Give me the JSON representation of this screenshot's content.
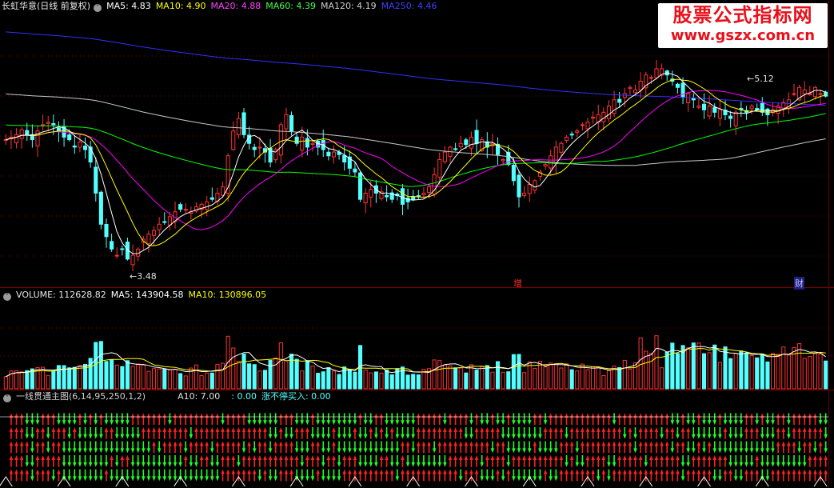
{
  "colors": {
    "up": "#ff3232",
    "down": "#54ffff",
    "ma5": "#ffffff",
    "ma10": "#ffff00",
    "ma20": "#ff00ff",
    "ma60": "#00ff00",
    "ma120": "#c8c8c8",
    "ma250": "#3030ff",
    "grid": "#800000",
    "arrow_up": "#ff2020",
    "arrow_down": "#20ff20"
  },
  "header": {
    "stock": "长虹华意(日线 前复权)",
    "ma5": "MA5: 4.83",
    "ma10": "MA10: 4.90",
    "ma20": "MA20: 4.88",
    "ma60": "MA60: 4.39",
    "ma120": "MA120: 4.19",
    "ma250": "MA250: 4.46"
  },
  "volume_header": {
    "title": "VOLUME: 112628.82",
    "ma5": "MA5: 143904.58",
    "ma10": "MA10: 130896.05"
  },
  "indicator_header": {
    "title": "一线贯通主图(6,14,95,250,1,2)",
    "a10": "A10: 7.00",
    "blank": ": 0.00",
    "buy": "涨不停买入: 0.00"
  },
  "annotations": {
    "low": "←3.48",
    "high": "←5.12",
    "tag1": "增",
    "tag2": "财"
  },
  "watermark": {
    "line1": "股票公式指标网",
    "line2": "www.gszx.com.cn"
  },
  "chart_data": [
    {
      "type": "candlestick",
      "title": "长虹华意(日线 前复权)",
      "ylim": [
        3.3,
        5.5
      ],
      "notes": "daily candles, ~160 sessions; O/H/L/C approximated from the plot",
      "close": [
        4.48,
        4.5,
        4.52,
        4.56,
        4.52,
        4.48,
        4.55,
        4.6,
        4.62,
        4.6,
        4.55,
        4.5,
        4.48,
        4.42,
        4.46,
        4.4,
        4.3,
        4.05,
        3.8,
        3.7,
        3.6,
        3.55,
        3.6,
        3.52,
        3.55,
        3.6,
        3.68,
        3.72,
        3.75,
        3.8,
        3.82,
        3.86,
        3.9,
        3.92,
        3.92,
        3.9,
        3.94,
        3.96,
        3.98,
        4.0,
        4.05,
        4.1,
        4.35,
        4.55,
        4.65,
        4.52,
        4.45,
        4.4,
        4.42,
        4.38,
        4.3,
        4.4,
        4.6,
        4.68,
        4.55,
        4.45,
        4.5,
        4.42,
        4.45,
        4.42,
        4.4,
        4.35,
        4.38,
        4.36,
        4.3,
        4.25,
        4.22,
        4.0,
        4.05,
        4.08,
        4.05,
        4.06,
        4.02,
        4.0,
        4.03,
        3.96,
        3.98,
        4.0,
        4.02,
        4.05,
        4.1,
        4.2,
        4.32,
        4.38,
        4.42,
        4.4,
        4.45,
        4.44,
        4.5,
        4.45,
        4.48,
        4.42,
        4.45,
        4.36,
        4.32,
        4.28,
        4.15,
        4.02,
        4.05,
        4.12,
        4.15,
        4.22,
        4.28,
        4.35,
        4.42,
        4.45,
        4.5,
        4.52,
        4.55,
        4.6,
        4.62,
        4.66,
        4.68,
        4.7,
        4.75,
        4.8,
        4.78,
        4.85,
        4.9,
        4.88,
        4.95,
        5.0,
        4.98,
        5.05,
        5.05,
        5.0,
        4.95,
        4.9,
        4.82,
        4.85,
        4.8,
        4.75,
        4.72,
        4.75,
        4.7,
        4.72,
        4.68,
        4.65,
        4.7,
        4.72,
        4.7,
        4.75,
        4.72,
        4.7,
        4.68,
        4.72,
        4.75,
        4.78,
        4.8,
        4.85,
        4.9,
        4.88,
        4.85,
        4.9,
        4.85,
        4.83
      ],
      "series": [
        {
          "name": "MA5",
          "value_last": 4.83
        },
        {
          "name": "MA10",
          "value_last": 4.9
        },
        {
          "name": "MA20",
          "value_last": 4.88
        },
        {
          "name": "MA60",
          "value_last": 4.39
        },
        {
          "name": "MA120",
          "value_last": 4.19
        },
        {
          "name": "MA250",
          "value_last": 4.46
        }
      ],
      "annotations": [
        {
          "text": "←3.48",
          "value": 3.48
        },
        {
          "text": "←5.12",
          "value": 5.12
        }
      ]
    },
    {
      "type": "bar",
      "title": "VOLUME",
      "ylim": [
        0,
        420000
      ],
      "series": [
        {
          "name": "VOLUME",
          "value_last": 112628.82
        },
        {
          "name": "MA5",
          "value_last": 143904.58
        },
        {
          "name": "MA10",
          "value_last": 130896.05
        }
      ]
    },
    {
      "type": "signal",
      "title": "一线贯通主图(6,14,95,250,1,2)",
      "series": [
        {
          "name": "A10",
          "value_last": 7.0
        },
        {
          "name": "涨不停买入",
          "value_last": 0.0
        }
      ]
    }
  ]
}
